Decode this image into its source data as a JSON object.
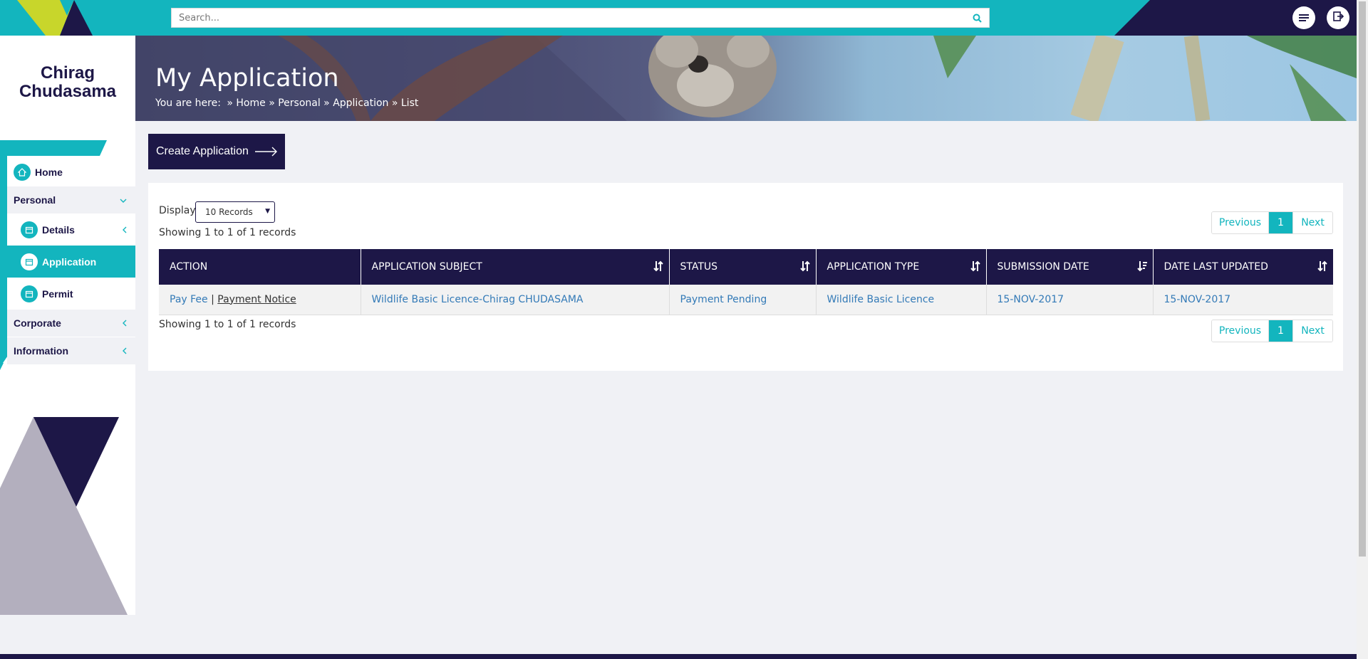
{
  "header": {
    "search_placeholder": "Search..."
  },
  "sidebar": {
    "user_first": "Chirag",
    "user_last": "Chudasama",
    "home": "Home",
    "personal": "Personal",
    "personal_items": [
      "Details",
      "Application",
      "Permit"
    ],
    "corporate": "Corporate",
    "information": "Information"
  },
  "banner": {
    "title": "My Application",
    "you_are_here": "You are here:",
    "breadcrumb": "» Home » Personal » Application » List"
  },
  "actions": {
    "create_label": "Create Application"
  },
  "table_controls": {
    "display_label": "Display",
    "display_value": "10 Records",
    "showing_top": "Showing 1 to 1 of 1 records",
    "showing_bottom": "Showing 1 to 1 of 1 records",
    "previous": "Previous",
    "page": "1",
    "next": "Next"
  },
  "table": {
    "headers": [
      "ACTION",
      "APPLICATION SUBJECT",
      "STATUS",
      "APPLICATION TYPE",
      "SUBMISSION DATE",
      "DATE LAST UPDATED"
    ],
    "rows": [
      {
        "action_pay": "Pay Fee",
        "action_sep": "|",
        "action_notice": "Payment Notice",
        "subject": "Wildlife Basic Licence-Chirag CHUDASAMA",
        "status": "Payment Pending",
        "type": "Wildlife Basic Licence",
        "submitted": "15-NOV-2017",
        "updated": "15-NOV-2017"
      }
    ]
  },
  "colors": {
    "teal": "#13b5be",
    "navy": "#1d1747",
    "lime": "#c8d62b",
    "grey_shape": "#b3afbe"
  }
}
